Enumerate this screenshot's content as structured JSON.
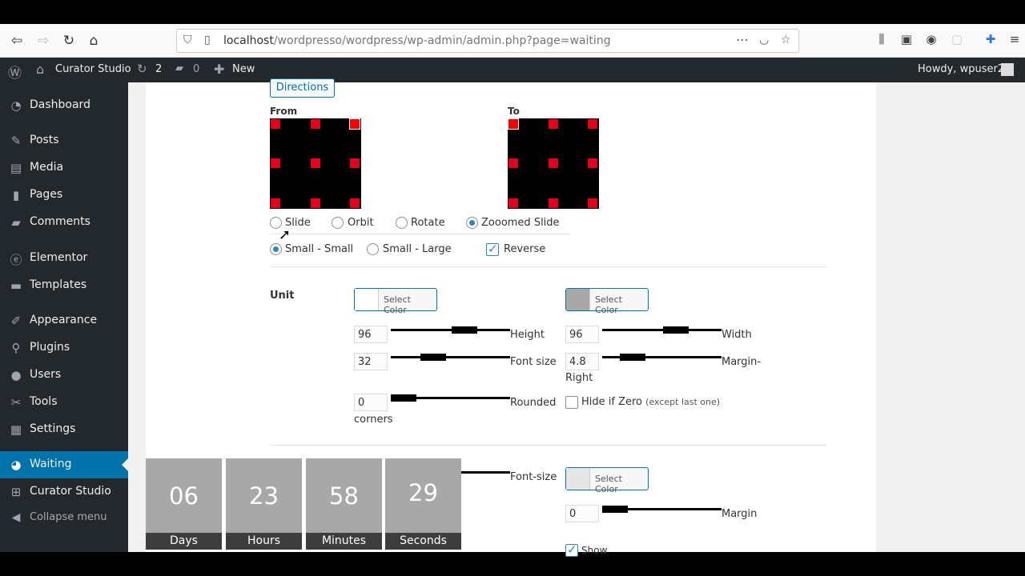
{
  "browser": {
    "url_host": "localhost",
    "url_path": "/wordpresso/wordpress/wp-admin/admin.php?page=waiting"
  },
  "adminbar": {
    "site_name": "Curator Studio",
    "updates_count": "2",
    "comments_count": "0",
    "new_label": "New",
    "howdy": "Howdy, wpuser2"
  },
  "sidebar": {
    "items": [
      {
        "label": "Dashboard",
        "icon": "dashboard-icon"
      },
      {
        "label": "Posts",
        "icon": "pin-icon"
      },
      {
        "label": "Media",
        "icon": "media-icon"
      },
      {
        "label": "Pages",
        "icon": "pages-icon"
      },
      {
        "label": "Comments",
        "icon": "comment-icon"
      },
      {
        "label": "Elementor",
        "icon": "elementor-icon"
      },
      {
        "label": "Templates",
        "icon": "folder-icon"
      },
      {
        "label": "Appearance",
        "icon": "brush-icon"
      },
      {
        "label": "Plugins",
        "icon": "plugin-icon"
      },
      {
        "label": "Users",
        "icon": "user-icon"
      },
      {
        "label": "Tools",
        "icon": "wrench-icon"
      },
      {
        "label": "Settings",
        "icon": "settings-icon"
      },
      {
        "label": "Waiting",
        "icon": "pie-icon"
      },
      {
        "label": "Curator Studio",
        "icon": "network-icon"
      }
    ],
    "collapse_label": "Collapse menu"
  },
  "settings": {
    "directions_label": "Directions",
    "from_label": "From",
    "to_label": "To",
    "anim_options": [
      "Slide",
      "Orbit",
      "Rotate",
      "Zooomed Slide"
    ],
    "anim_selected": "Zooomed Slide",
    "size_options": [
      "Small - Small",
      "Small - Large"
    ],
    "size_selected": "Small - Small",
    "reverse_label": "Reverse",
    "reverse_checked": true,
    "unit_label": "Unit",
    "select_color": "Select Color",
    "height_label": "Height",
    "height_value": "96",
    "width_label": "Width",
    "width_value": "96",
    "font_size_label": "Font size",
    "font_size_value": "32",
    "margin_right_label_1": "Margin-",
    "margin_right_label_2": "Right",
    "margin_right_value": "4.8",
    "rounded_label": "Rounded",
    "corners_label": "corners",
    "rounded_value": "0",
    "hide_zero_label": "Hide if Zero",
    "hide_zero_note": "(except last one)",
    "font_size_label_2": "Font-size",
    "margin_label": "Margin",
    "margin_value": "0",
    "show_label": "Show"
  },
  "countdown": [
    {
      "value": "06",
      "label": "Days"
    },
    {
      "value": "23",
      "label": "Hours"
    },
    {
      "value": "58",
      "label": "Minutes"
    },
    {
      "value": "29",
      "label": "Seconds"
    }
  ],
  "colors": {
    "wp_dark": "#23282d",
    "wp_blue": "#0073aa",
    "tile_grey": "#a8a8a8",
    "square_red": "#e2001a"
  }
}
